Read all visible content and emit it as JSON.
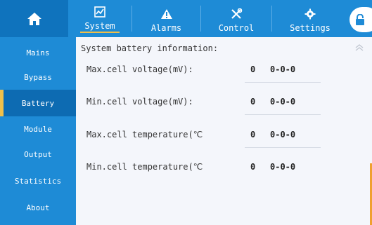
{
  "header": {
    "tabs": [
      {
        "label": "System",
        "icon": "chart-icon"
      },
      {
        "label": "Alarms",
        "icon": "warning-icon"
      },
      {
        "label": "Control",
        "icon": "tools-icon"
      },
      {
        "label": "Settings",
        "icon": "gear-icon"
      }
    ],
    "active_tab": "System"
  },
  "sidebar": {
    "items": [
      {
        "label": "Mains"
      },
      {
        "label": "Bypass"
      },
      {
        "label": "Battery"
      },
      {
        "label": "Module"
      },
      {
        "label": "Output"
      },
      {
        "label": "Statistics"
      },
      {
        "label": "About"
      }
    ],
    "active": "Battery"
  },
  "main": {
    "title": "System battery information:",
    "rows": [
      {
        "label": "Max.cell voltage(mV):",
        "value": "0",
        "extra": "0-0-0"
      },
      {
        "label": "Min.cell voltage(mV):",
        "value": "0",
        "extra": "0-0-0"
      },
      {
        "label": "Max.cell temperature(℃",
        "value": "0",
        "extra": "0-0-0"
      },
      {
        "label": "Min.cell temperature(℃",
        "value": "0",
        "extra": "0-0-0"
      }
    ]
  },
  "colors": {
    "primary": "#1e8bd6",
    "dark": "#0f73bd",
    "accent": "#f0c04a",
    "background": "#f4f6fb"
  }
}
